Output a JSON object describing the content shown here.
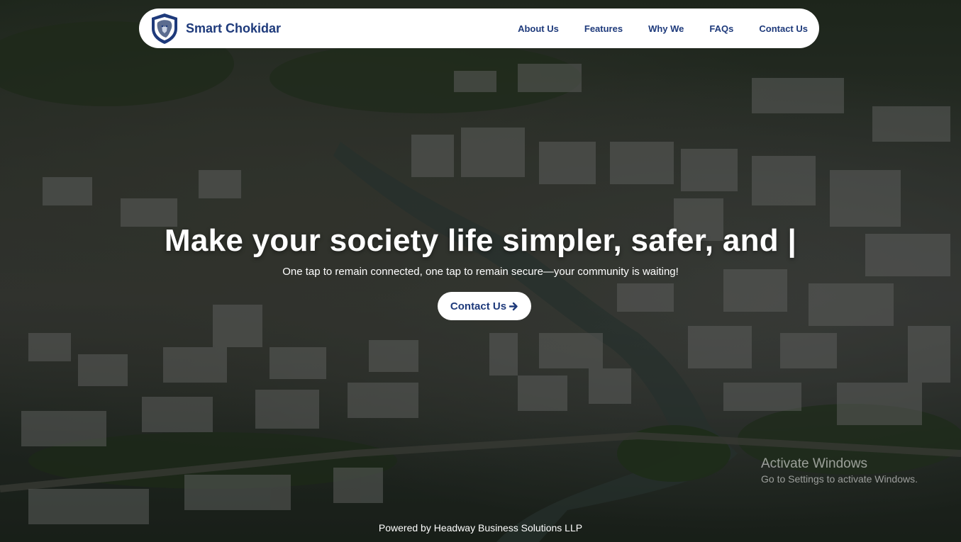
{
  "navbar": {
    "brand": "Smart Chokidar",
    "links": [
      "About Us",
      "Features",
      "Why We",
      "FAQs",
      "Contact Us"
    ]
  },
  "hero": {
    "headline": "Make your society life simpler, safer, and |",
    "subline": "One tap to remain connected, one tap to remain secure—your community is waiting!",
    "cta_label": "Contact Us",
    "cta_icon": "arrow-right-icon"
  },
  "footer": {
    "text": "Powered by Headway Business Solutions LLP"
  },
  "watermark": {
    "title": "Activate Windows",
    "subtitle": "Go to Settings to activate Windows."
  },
  "colors": {
    "brand": "#1e3a7b",
    "nav_bg": "#ffffff"
  }
}
